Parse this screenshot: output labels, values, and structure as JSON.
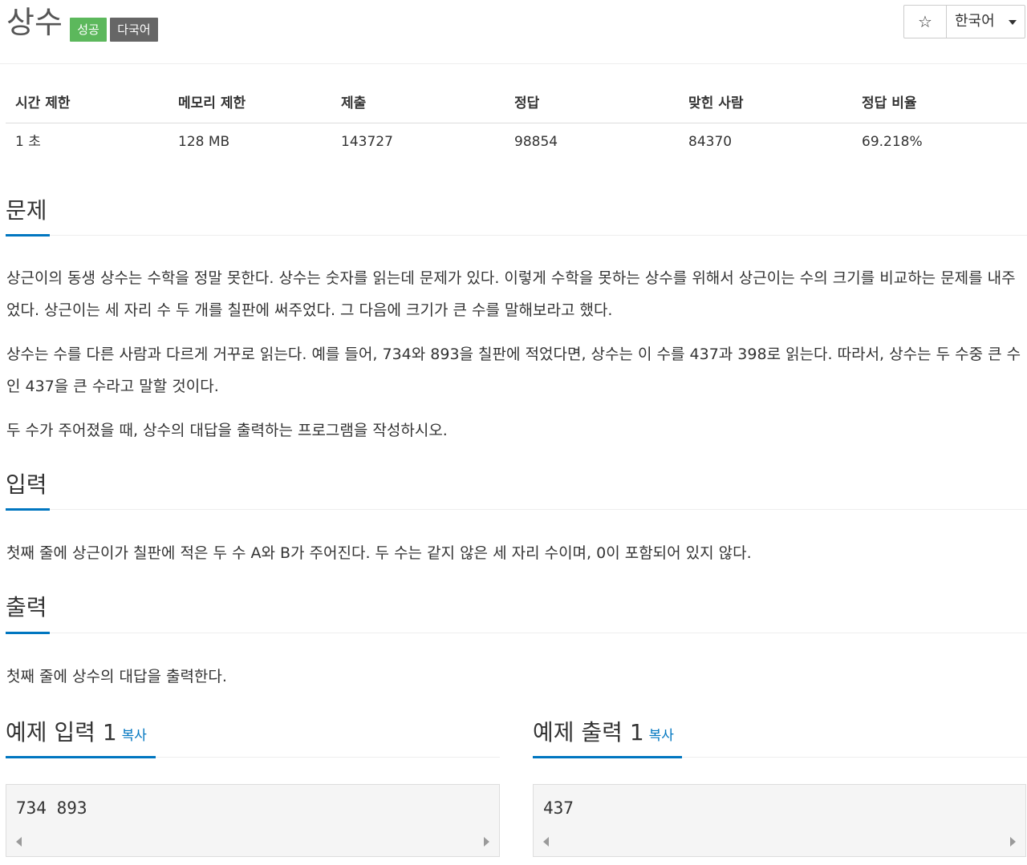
{
  "problem": {
    "title": "상수",
    "labels": {
      "success": "성공",
      "multilang": "다국어"
    },
    "star_icon": "☆",
    "language": "한국어"
  },
  "stats": {
    "headers": [
      "시간 제한",
      "메모리 제한",
      "제출",
      "정답",
      "맞힌 사람",
      "정답 비율"
    ],
    "values": [
      "1 초",
      "128 MB",
      "143727",
      "98854",
      "84370",
      "69.218%"
    ]
  },
  "sections": {
    "problem_heading": "문제",
    "problem_paragraphs": [
      "상근이의 동생 상수는 수학을 정말 못한다. 상수는 숫자를 읽는데 문제가 있다. 이렇게 수학을 못하는 상수를 위해서 상근이는 수의 크기를 비교하는 문제를 내주었다. 상근이는 세 자리 수 두 개를 칠판에 써주었다. 그 다음에 크기가 큰 수를 말해보라고 했다.",
      "상수는 수를 다른 사람과 다르게 거꾸로 읽는다. 예를 들어, 734와 893을 칠판에 적었다면, 상수는 이 수를 437과 398로 읽는다. 따라서, 상수는 두 수중 큰 수인 437을 큰 수라고 말할 것이다.",
      "두 수가 주어졌을 때, 상수의 대답을 출력하는 프로그램을 작성하시오."
    ],
    "input_heading": "입력",
    "input_text": "첫째 줄에 상근이가 칠판에 적은 두 수 A와 B가 주어진다. 두 수는 같지 않은 세 자리 수이며, 0이 포함되어 있지 않다.",
    "output_heading": "출력",
    "output_text": "첫째 줄에 상수의 대답을 출력한다."
  },
  "samples": {
    "input_title": "예제 입력 1",
    "output_title": "예제 출력 1",
    "copy_label": "복사",
    "input_value": "734 893",
    "output_value": "437"
  }
}
